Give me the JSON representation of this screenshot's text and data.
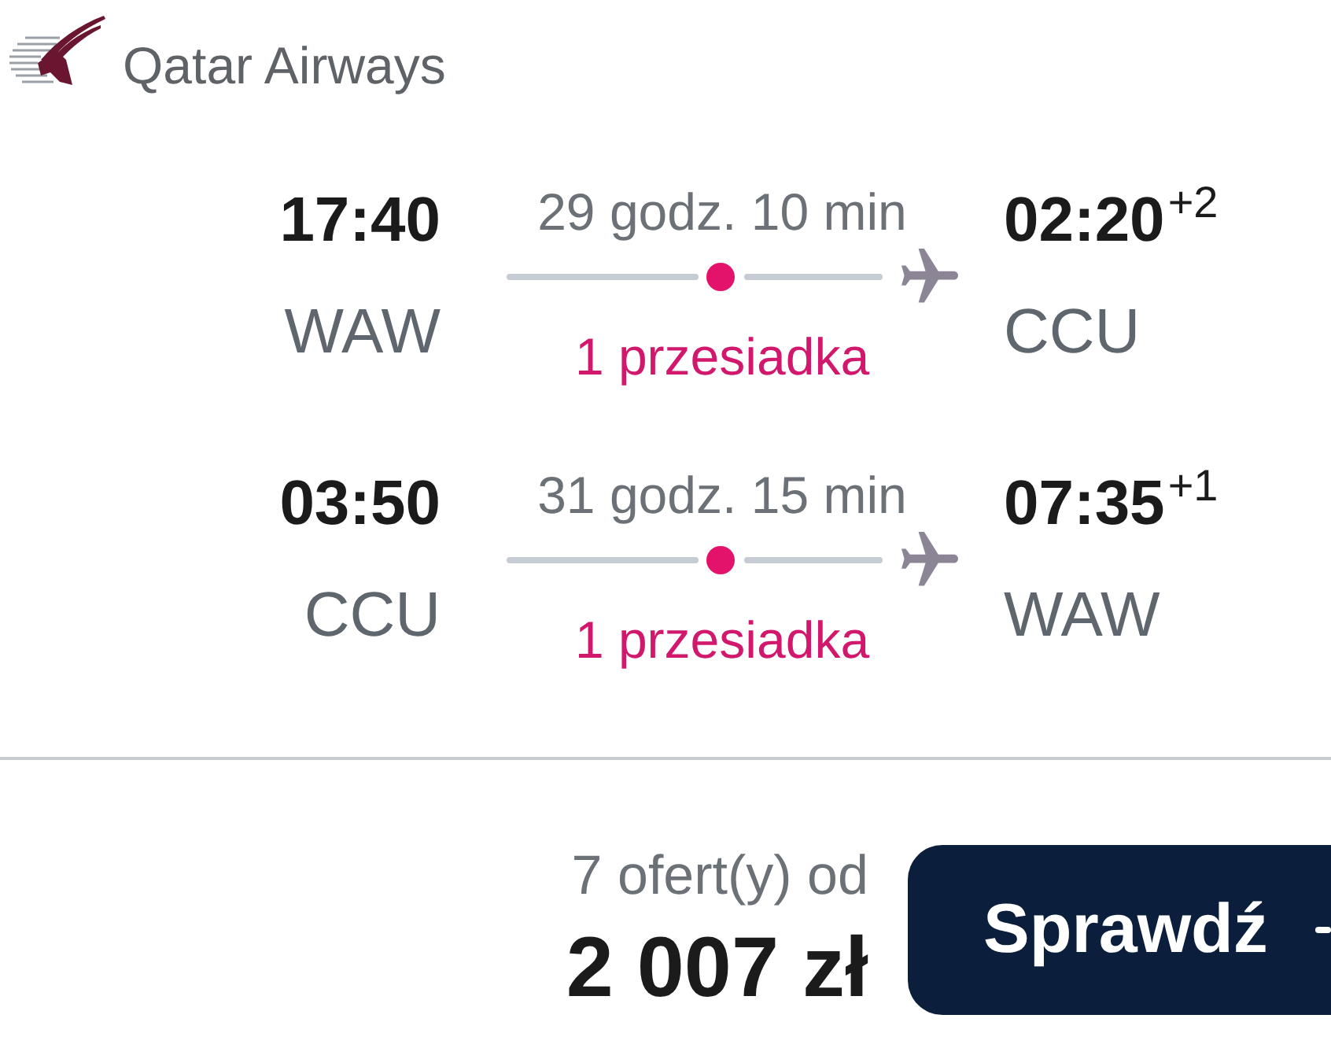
{
  "header": {
    "airline": "Qatar Airways"
  },
  "legs": [
    {
      "departure_time": "17:40",
      "departure_airport": "WAW",
      "duration": "29 godz. 10 min",
      "stops": "1 przesiadka",
      "arrival_time": "02:20",
      "arrival_day_offset": "+2",
      "arrival_airport": "CCU"
    },
    {
      "departure_time": "03:50",
      "departure_airport": "CCU",
      "duration": "31 godz. 15 min",
      "stops": "1 przesiadka",
      "arrival_time": "07:35",
      "arrival_day_offset": "+1",
      "arrival_airport": "WAW"
    }
  ],
  "offer": {
    "offers_label": "7 ofert(y) od",
    "price": "2 007 zł",
    "button": {
      "label": "Sprawdź"
    }
  }
}
